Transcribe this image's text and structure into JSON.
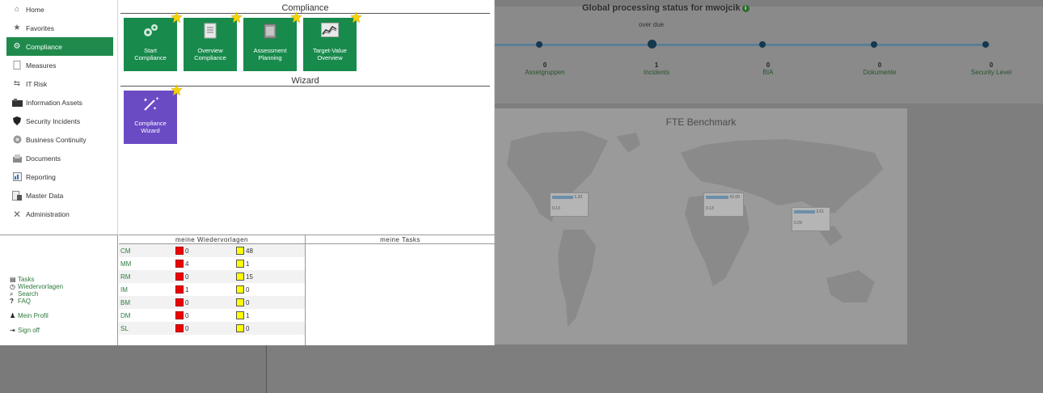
{
  "background": {
    "title": "Global processing status for mwojcik",
    "subtitle": "over due",
    "stats": [
      {
        "num": "0",
        "label": "Assetgruppen"
      },
      {
        "num": "1",
        "label": "Incidents"
      },
      {
        "num": "0",
        "label": "BIA"
      },
      {
        "num": "0",
        "label": "Dokumente"
      },
      {
        "num": "0",
        "label": "Security Level"
      }
    ],
    "map": {
      "title": "FTE Benchmark",
      "boxes": [
        {
          "a": "1.33",
          "b": "0.13"
        },
        {
          "a": "42.09",
          "b": "0.13"
        },
        {
          "a": "3.61",
          "b": "0.29"
        }
      ]
    }
  },
  "sidebar": {
    "items": [
      {
        "label": "Home",
        "icon": "home-icon"
      },
      {
        "label": "Favorites",
        "icon": "star-icon"
      },
      {
        "label": "Compliance",
        "icon": "gears-icon",
        "active": true
      },
      {
        "label": "Measures",
        "icon": "document-icon"
      },
      {
        "label": "IT Risk",
        "icon": "network-icon"
      },
      {
        "label": "Information Assets",
        "icon": "assets-icon"
      },
      {
        "label": "Security Incidents",
        "icon": "shield-icon"
      },
      {
        "label": "Business Continuity",
        "icon": "continuity-icon"
      },
      {
        "label": "Documents",
        "icon": "documents-icon"
      },
      {
        "label": "Reporting",
        "icon": "report-icon"
      },
      {
        "label": "Master Data",
        "icon": "master-data-icon"
      },
      {
        "label": "Administration",
        "icon": "tools-icon"
      }
    ]
  },
  "compliance": {
    "heading": "Compliance",
    "tiles": [
      {
        "line1": "Start",
        "line2": "Compliance"
      },
      {
        "line1": "Overview",
        "line2": "Compliance"
      },
      {
        "line1": "Assessment",
        "line2": "Planning"
      },
      {
        "line1": "Target-Value",
        "line2": "Overview"
      }
    ]
  },
  "wizard": {
    "heading": "Wizard",
    "tiles": [
      {
        "line1": "Compliance",
        "line2": "Wizard"
      }
    ]
  },
  "quick_links": {
    "tasks": "Tasks",
    "wiedervorlagen": "Wiedervorlagen",
    "search": "Search",
    "faq": "FAQ",
    "profile": "Mein Profil",
    "signoff": "Sign off"
  },
  "wiedervorlagen": {
    "heading": "meine Wiedervorlagen",
    "rows": [
      {
        "code": "CM",
        "red": "0",
        "yellow": "48"
      },
      {
        "code": "MM",
        "red": "4",
        "yellow": "1"
      },
      {
        "code": "RM",
        "red": "0",
        "yellow": "15"
      },
      {
        "code": "IM",
        "red": "1",
        "yellow": "0"
      },
      {
        "code": "BM",
        "red": "0",
        "yellow": "0"
      },
      {
        "code": "DM",
        "red": "0",
        "yellow": "1"
      },
      {
        "code": "SL",
        "red": "0",
        "yellow": "0"
      }
    ]
  },
  "tasks": {
    "heading": "meine Tasks"
  },
  "colors": {
    "accent_green": "#188a4c",
    "wizard_purple": "#6a4bc4",
    "overdue_red": "#e00000",
    "pending_yellow": "#ffff00"
  }
}
